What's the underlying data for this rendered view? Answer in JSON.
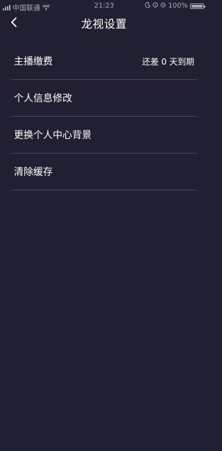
{
  "status_bar": {
    "carrier": "中国联通",
    "time": "21:23",
    "battery_text": "100%",
    "battery_level": 1.0
  },
  "nav": {
    "title": "龙视设置",
    "back_icon": "chevron-left-icon"
  },
  "menu": {
    "items": [
      {
        "label": "主播缴费",
        "value": "还差 0 天到期"
      },
      {
        "label": "个人信息修改",
        "value": ""
      },
      {
        "label": "更换个人中心背景",
        "value": ""
      },
      {
        "label": "清除缓存",
        "value": ""
      }
    ]
  },
  "colors": {
    "background": "#212033",
    "divider": "#45445a",
    "text": "#ffffff",
    "status_text": "#a9a9b6"
  }
}
